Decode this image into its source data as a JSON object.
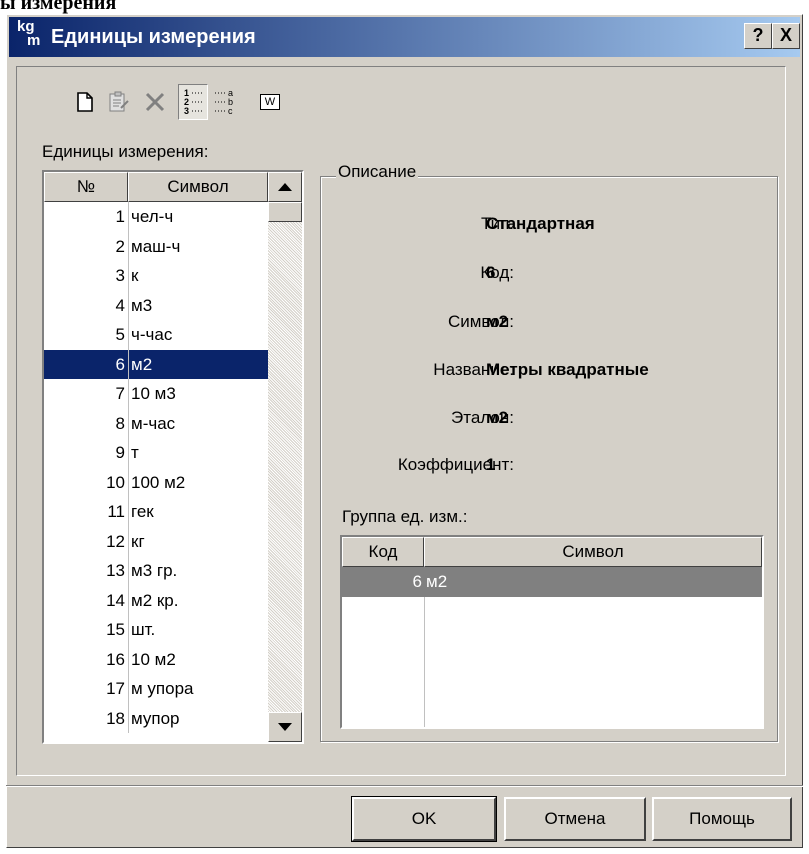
{
  "background_caption": "ы измерения",
  "window": {
    "icon_top": "kg",
    "icon_bottom": "m",
    "title": "Единицы измерения",
    "help_button": "?",
    "close_button": "X"
  },
  "toolbar": {
    "icons": [
      "new-document-icon",
      "properties-icon",
      "delete-icon",
      "sort-numeric-icon",
      "sort-alpha-icon",
      "w-icon"
    ],
    "w_label": "W",
    "sort_numeric_label": "1 2 3",
    "sort_alpha_label": "a b c"
  },
  "units_list": {
    "label": "Единицы измерения:",
    "columns": [
      "№",
      "Символ"
    ],
    "rows": [
      {
        "num": "1",
        "symbol": "чел-ч"
      },
      {
        "num": "2",
        "symbol": "маш-ч"
      },
      {
        "num": "3",
        "symbol": "к"
      },
      {
        "num": "4",
        "symbol": "м3"
      },
      {
        "num": "5",
        "symbol": "ч-час"
      },
      {
        "num": "6",
        "symbol": "м2"
      },
      {
        "num": "7",
        "symbol": "10 м3"
      },
      {
        "num": "8",
        "symbol": "м-час"
      },
      {
        "num": "9",
        "symbol": "т"
      },
      {
        "num": "10",
        "symbol": "100 м2"
      },
      {
        "num": "11",
        "symbol": "гек"
      },
      {
        "num": "12",
        "symbol": "кг"
      },
      {
        "num": "13",
        "symbol": "м3 гр."
      },
      {
        "num": "14",
        "symbol": "м2 кр."
      },
      {
        "num": "15",
        "symbol": "шт."
      },
      {
        "num": "16",
        "symbol": "10 м2"
      },
      {
        "num": "17",
        "symbol": "м упора"
      },
      {
        "num": "18",
        "symbol": "мупор"
      }
    ],
    "selected_index": 5
  },
  "description": {
    "title": "Описание",
    "type_label": "Тип:",
    "type_value": "Стандартная",
    "code_label": "Код:",
    "code_value": "6",
    "symbol_label": "Символ:",
    "symbol_value": "м2",
    "name_label": "Название:",
    "name_value": "Метры квадратные",
    "etalon_label": "Эталон:",
    "etalon_value": "м2",
    "coef_label": "Коэффициент:",
    "coef_value": "1",
    "group_label": "Группа ед. изм.:",
    "group_columns": [
      "Код",
      "Символ"
    ],
    "group_rows": [
      {
        "code": "6",
        "symbol": "м2"
      }
    ]
  },
  "buttons": {
    "ok": "OK",
    "cancel": "Отмена",
    "help": "Помощь"
  }
}
